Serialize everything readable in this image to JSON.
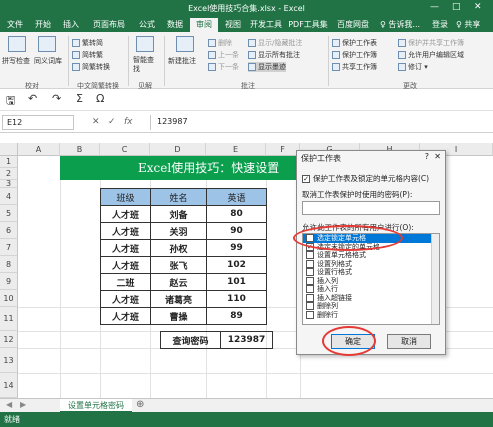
{
  "window": {
    "title": "Excel使用技巧合集.xlsx - Excel",
    "minimize": "—",
    "maximize": "□",
    "close": "✕"
  },
  "ribbon_tabs": [
    "文件",
    "开始",
    "插入",
    "页面布局",
    "公式",
    "数据",
    "审阅",
    "视图",
    "开发工具",
    "PDF工具集",
    "百度网盘"
  ],
  "active_tab": "审阅",
  "tell_me": "♀ 告诉我...",
  "login": "登录",
  "share": "♀ 共享",
  "ribbon": {
    "spell": "拼写检查",
    "thesaurus": "同义词库",
    "proof_group": "校对",
    "trad_to_simp": "繁转简",
    "simp_to_trad": "简转繁",
    "conversion": "简繁转换",
    "chinese_group": "中文简繁转换",
    "smart_lookup": "智能查找",
    "insights_group": "见解",
    "new_comment": "新建批注",
    "delete": "删除",
    "prev": "上一条",
    "next": "下一条",
    "show_hide_comment": "显示/隐藏批注",
    "show_all_comments": "显示所有批注",
    "show_ink": "显示墨迹",
    "comments_group": "批注",
    "protect_sheet": "保护工作表",
    "protect_workbook": "保护工作簿",
    "share_workbook": "共享工作簿",
    "protect_share": "保护并共享工作簿",
    "allow_edit": "允许用户编辑区域",
    "track_changes": "修订",
    "changes_group": "更改"
  },
  "qat": {
    "save": "🖫",
    "undo": "↶",
    "redo": "↷",
    "sigma": "Σ",
    "omega": "Ω"
  },
  "formula_bar": {
    "cell": "E12",
    "cancel": "✕",
    "enter": "✓",
    "fx": "fx",
    "value": "123987"
  },
  "columns": [
    "A",
    "B",
    "C",
    "D",
    "E",
    "F",
    "G",
    "H",
    "I"
  ],
  "rows": [
    "1",
    "2",
    "3",
    "4",
    "5",
    "6",
    "7",
    "8",
    "9",
    "10",
    "11",
    "12",
    "13",
    "14"
  ],
  "banner_text": "Excel使用技巧：快速设置",
  "table": {
    "header": [
      "班级",
      "姓名",
      "英语"
    ],
    "rows": [
      [
        "人才班",
        "刘备",
        "80"
      ],
      [
        "人才班",
        "关羽",
        "90"
      ],
      [
        "人才班",
        "孙权",
        "99"
      ],
      [
        "人才班",
        "张飞",
        "102"
      ],
      [
        "二班",
        "赵云",
        "101"
      ],
      [
        "人才班",
        "诸葛亮",
        "110"
      ],
      [
        "人才班",
        "曹操",
        "89"
      ]
    ]
  },
  "password_row": {
    "label": "查询密码",
    "value": "123987"
  },
  "sheet_tab": "设置单元格密码",
  "status_left": "就绪",
  "dialog": {
    "title": "保护工作表",
    "help": "?",
    "close": "✕",
    "protect_checkbox": "保护工作表及锁定的单元格内容(C)",
    "password_label": "取消工作表保护时使用的密码(P):",
    "allow_label": "允许此工作表的所有用户进行(O):",
    "permissions": [
      "选定锁定单元格",
      "选定未锁定的单元格",
      "设置单元格格式",
      "设置列格式",
      "设置行格式",
      "插入列",
      "插入行",
      "插入超链接",
      "删除列",
      "删除行"
    ],
    "ok": "确定",
    "cancel": "取消"
  },
  "colors": {
    "excel_green": "#217346",
    "banner_green": "#0b9e4d",
    "header_blue": "#9dc3e6",
    "highlight_red": "#e53935",
    "selection_blue": "#0078d7"
  }
}
